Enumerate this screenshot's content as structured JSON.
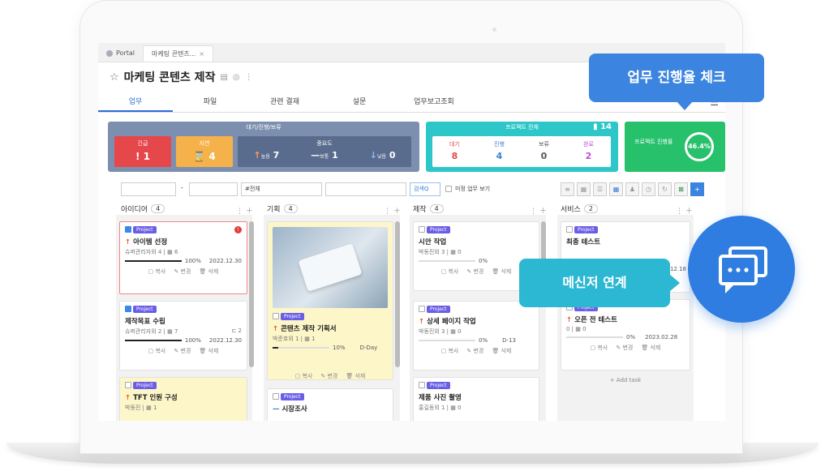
{
  "tabs": {
    "portal": "Portal",
    "current": "마케팅 콘텐츠...",
    "close": "×"
  },
  "page_title": "마케팅 콘텐츠 제작",
  "menu": [
    "업무",
    "파일",
    "관련 결재",
    "설문",
    "업무보고조회"
  ],
  "summary": {
    "waiting_header": "대기/진행/보류",
    "urgent_label": "긴급",
    "urgent_value": "! 1",
    "delay_label": "지연",
    "delay_value": "⌛ 4",
    "importance_label": "중요도",
    "imp_high_label": "높음",
    "imp_high_value": "7",
    "imp_mid_label": "보통",
    "imp_mid_value": "1",
    "imp_low_label": "낮음",
    "imp_low_value": "0",
    "project_header": "프로젝트 전체",
    "project_total": "14",
    "status": [
      {
        "label": "대기",
        "value": "8"
      },
      {
        "label": "진행",
        "value": "4"
      },
      {
        "label": "보류",
        "value": "0"
      },
      {
        "label": "완료",
        "value": "2"
      }
    ],
    "rate_label": "프로젝트 진행률",
    "rate_value": "46.4%",
    "rate_fraction": 0.464
  },
  "filters": {
    "dash": "-",
    "all": "#전체",
    "search_btn": "검색Q",
    "unassigned": "미정 업무 보기"
  },
  "columns": [
    {
      "name": "아이디어",
      "count": "4"
    },
    {
      "name": "기획",
      "count": "4"
    },
    {
      "name": "제작",
      "count": "4"
    },
    {
      "name": "서비스",
      "count": "2"
    }
  ],
  "badge": "Project",
  "cards": {
    "idea1": {
      "title": "아이템 선정",
      "meta": "슈퍼관리자외 4 | ▦ 6",
      "pct": "100%",
      "date": "2022.12.30"
    },
    "idea2": {
      "title": "제작목표 수립",
      "meta": "슈퍼관리자외 2 | ▦ 7",
      "extra": "⊏ 2",
      "pct": "100%",
      "date": "2022.12.30"
    },
    "idea3": {
      "title": "TFT 인원 구성",
      "meta": "박동진 | ▦ 1"
    },
    "plan1": {
      "title": "콘텐츠 제작 기획서",
      "meta": "박준호외 1 | ▦ 1",
      "pct": "10%",
      "date": "D-Day"
    },
    "plan2": {
      "title": "시장조사"
    },
    "make1": {
      "title": "시안 작업",
      "meta": "박동진외 3 | ▦ 0",
      "pct": "0%"
    },
    "make2": {
      "title": "상세 페이지 작업",
      "meta": "박동진외 3 | ▦ 0",
      "pct": "0%",
      "date": "D-13"
    },
    "make3": {
      "title": "제품 사진 촬영",
      "meta": "홍길동외 1 | ▦ 0"
    },
    "svc1": {
      "title": "최종 테스트",
      "date": "2022.12.18"
    },
    "svc2": {
      "title": "오픈 전 테스트",
      "meta": "0 | ▦ 0",
      "pct": "0%",
      "date": "2023.02.28"
    }
  },
  "actions": {
    "copy": "복사",
    "edit": "변경",
    "delete": "삭제"
  },
  "add_task": "+ Add task",
  "callouts": {
    "progress_check": "업무 진행율 체크",
    "messenger": "메신저 연계"
  }
}
